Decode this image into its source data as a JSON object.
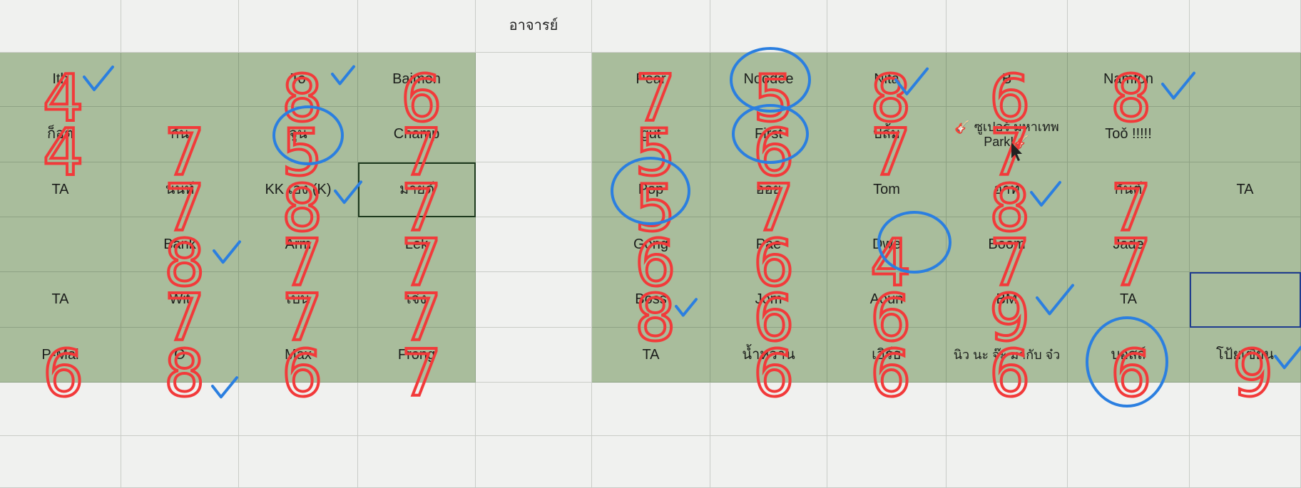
{
  "header": {
    "title": "อาจารย์"
  },
  "left_block": {
    "rows": [
      [
        "Ith",
        "",
        "To",
        "Baimon"
      ],
      [
        "ก็อต",
        "กัน",
        "จูน",
        "Champ"
      ],
      [
        "TA",
        "นนท์",
        "KK เอง (K)",
        "มายด์"
      ],
      [
        "",
        "Bank",
        "Arm",
        "Lek"
      ],
      [
        "TA",
        "Wit",
        "เบน",
        "เจ๋ง"
      ],
      [
        "P-Mai",
        "O",
        "Max",
        "Frong"
      ]
    ]
  },
  "right_block": {
    "rows": [
      [
        "Pear",
        "Noodee",
        "Nita",
        "B",
        "Namfon",
        ""
      ],
      [
        "gut",
        "First",
        "ปลื้ม",
        "🎸 ซูเปอร์ มหาเทพ Park!🎸",
        "Toǒ !!!!!",
        ""
      ],
      [
        "Pop",
        "ออย",
        "Tom",
        "อาท",
        "กันต์",
        "TA"
      ],
      [
        "Gong",
        "Pae",
        "Dwe",
        "Boom",
        "Jade",
        ""
      ],
      [
        "Boss",
        "Jom",
        "Aoun",
        "BM",
        "TA",
        ""
      ],
      [
        "TA",
        "น้ำหวาน",
        "เอิร์ธ",
        "นิว นะ จ๊ะ มากับ จ๋ว",
        "บอสส์",
        "โป้ยเซียน"
      ]
    ]
  },
  "handwritten_scores": {
    "left": [
      [
        "4",
        "",
        "8",
        "6"
      ],
      [
        "4",
        "7",
        "5",
        "7"
      ],
      [
        "",
        "7",
        "8",
        "7"
      ],
      [
        "",
        "8",
        "7",
        "7"
      ],
      [
        "",
        "7",
        "7",
        "7"
      ],
      [
        "6",
        "8",
        "6",
        "7"
      ]
    ],
    "right": [
      [
        "7",
        "5",
        "8",
        "6",
        "8",
        ""
      ],
      [
        "5",
        "6",
        "7",
        "7",
        "",
        ""
      ],
      [
        "5",
        "7",
        "",
        "8",
        "7",
        ""
      ],
      [
        "6",
        "6",
        "4",
        "7",
        "7",
        ""
      ],
      [
        "8",
        "6",
        "6",
        "9",
        "",
        ""
      ],
      [
        "",
        "6",
        "6",
        "6",
        "6",
        "9"
      ]
    ]
  },
  "colors": {
    "cell_green": "#a9bd9c",
    "ink_red": "#f23a3a",
    "ink_blue": "#2b7fe0",
    "selection_dark": "#1e3a1e",
    "selection_blue": "#1f3c8f"
  }
}
